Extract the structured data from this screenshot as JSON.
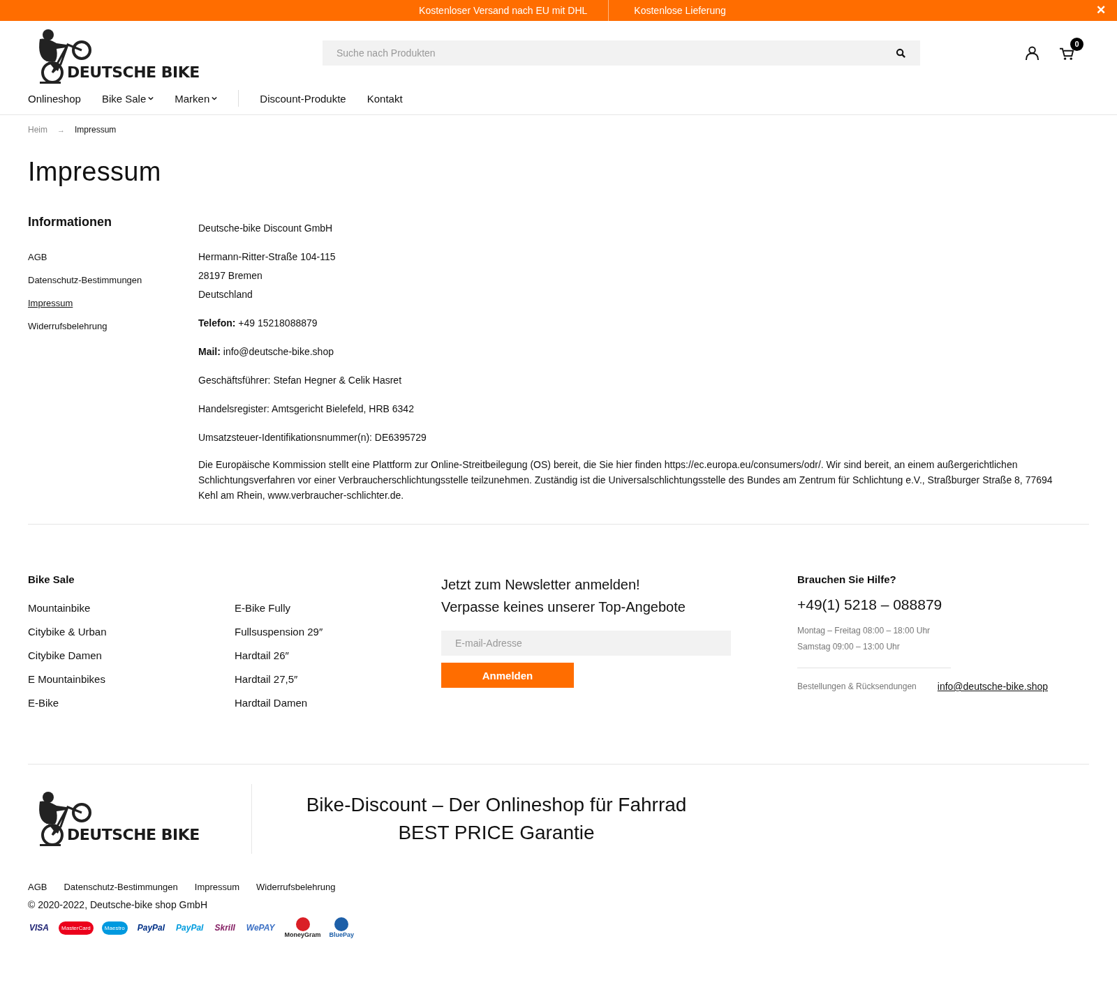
{
  "announcement": {
    "messages": [
      "Kostenloser Versand nach EU mit DHL",
      "Kostenlose Lieferung"
    ],
    "close": "✕"
  },
  "header": {
    "logo": "DEUTSCHE BIKE",
    "search": {
      "placeholder": "Suche nach Produkten"
    },
    "cart_count": "0",
    "nav": [
      {
        "label": "Onlineshop",
        "dropdown": false
      },
      {
        "label": "Bike Sale",
        "dropdown": true
      },
      {
        "label": "Marken",
        "dropdown": true
      },
      {
        "label": "Discount-Produkte",
        "dropdown": false
      },
      {
        "label": "Kontakt",
        "dropdown": false
      }
    ]
  },
  "breadcrumb": {
    "separator": "→",
    "items": [
      "Heim",
      "Impressum"
    ]
  },
  "title": "Impressum",
  "sidebar": {
    "heading": "Informationen",
    "items": [
      {
        "label": "AGB",
        "selected": false
      },
      {
        "label": "Datenschutz-Bestimmungen",
        "selected": false
      },
      {
        "label": "Impressum",
        "selected": true
      },
      {
        "label": "Widerrufsbelehrung",
        "selected": false
      }
    ]
  },
  "content": [
    [
      "Deutsche-bike Discount GmbH"
    ],
    [
      "Hermann-Ritter-Straße 104-115",
      "28197 Bremen",
      "Deutschland"
    ],
    [
      "**Telefon:** +49 15218088879"
    ],
    [
      "**Mail:** info@deutsche-bike.shop"
    ],
    [
      "Geschäftsführer: Stefan Hegner & Celik Hasret"
    ],
    [
      "Handelsregister: Amtsgericht Bielefeld, HRB 6342"
    ],
    [
      "Umsatzsteuer-Identifikationsnummer(n): DE6395729"
    ],
    [
      "Die Europäische Kommission stellt eine Plattform zur Online-Streitbeilegung (OS) bereit, die Sie hier finden https://ec.europa.eu/consumers/odr/. Wir sind bereit, an einem außergerichtlichen Schlichtungsverfahren vor einer Verbraucherschlichtungsstelle teilzunehmen. Zuständig ist die Universalschlichtungsstelle des Bundes am Zentrum für Schlichtung e.V., Straßburger Straße 8, 77694 Kehl am Rhein, www.verbraucher-schlichter.de."
    ]
  ],
  "footer": {
    "bike_sale": {
      "heading": "Bike Sale",
      "column_1": [
        "Mountainbike",
        "Citybike & Urban",
        "Citybike Damen",
        "E Mountainbikes",
        "E-Bike"
      ],
      "column_2": [
        "E-Bike Fully",
        "Fullsuspension 29″",
        "Hardtail 26″",
        "Hardtail 27,5″",
        "Hardtail Damen"
      ]
    },
    "newsletter": {
      "lines": [
        "Jetzt zum Newsletter anmelden!",
        "Verpasse keines unserer Top-Angebote"
      ],
      "placeholder": "E-mail-Adresse",
      "button": "Anmelden"
    },
    "help": {
      "heading": "Brauchen Sie Hilfe?",
      "phone": "+49(1) 5218 – 088879",
      "hours": [
        "Montag – Freitag 08:00 – 18:00 Uhr",
        "Samstag 09:00 – 13:00 Uhr"
      ],
      "orders_label": "Bestellungen & Rücksendungen",
      "email": "info@deutsche-bike.shop"
    },
    "logo": "DEUTSCHE BIKE",
    "slogan": [
      "Bike-Discount – Der Onlineshop für Fahrrad",
      "BEST PRICE Garantie"
    ],
    "links": [
      "AGB",
      "Datenschutz-Bestimmungen",
      "Impressum",
      "Widerrufsbelehrung"
    ],
    "copyright": "© 2020-2022, Deutsche-bike shop GmbH",
    "payments": [
      {
        "label": "VISA",
        "kind": "wordmark",
        "color": "#1a1f71"
      },
      {
        "label": "MasterCard",
        "kind": "circles",
        "color": "#eb001b"
      },
      {
        "label": "Maestro",
        "kind": "circles",
        "color": "#0099df"
      },
      {
        "label": "PayPal",
        "kind": "wordmark",
        "color": "#003087"
      },
      {
        "label": "PayPal",
        "kind": "wordmark",
        "color": "#009cde"
      },
      {
        "label": "Skrill",
        "kind": "wordmark",
        "color": "#862165"
      },
      {
        "label": "WePAY",
        "kind": "wordmark",
        "color": "#3a6fc4"
      },
      {
        "label": "MoneyGram",
        "kind": "globe",
        "color": "#da1f26"
      },
      {
        "label": "BluePay",
        "kind": "check",
        "color": "#1d5fa8"
      }
    ]
  }
}
